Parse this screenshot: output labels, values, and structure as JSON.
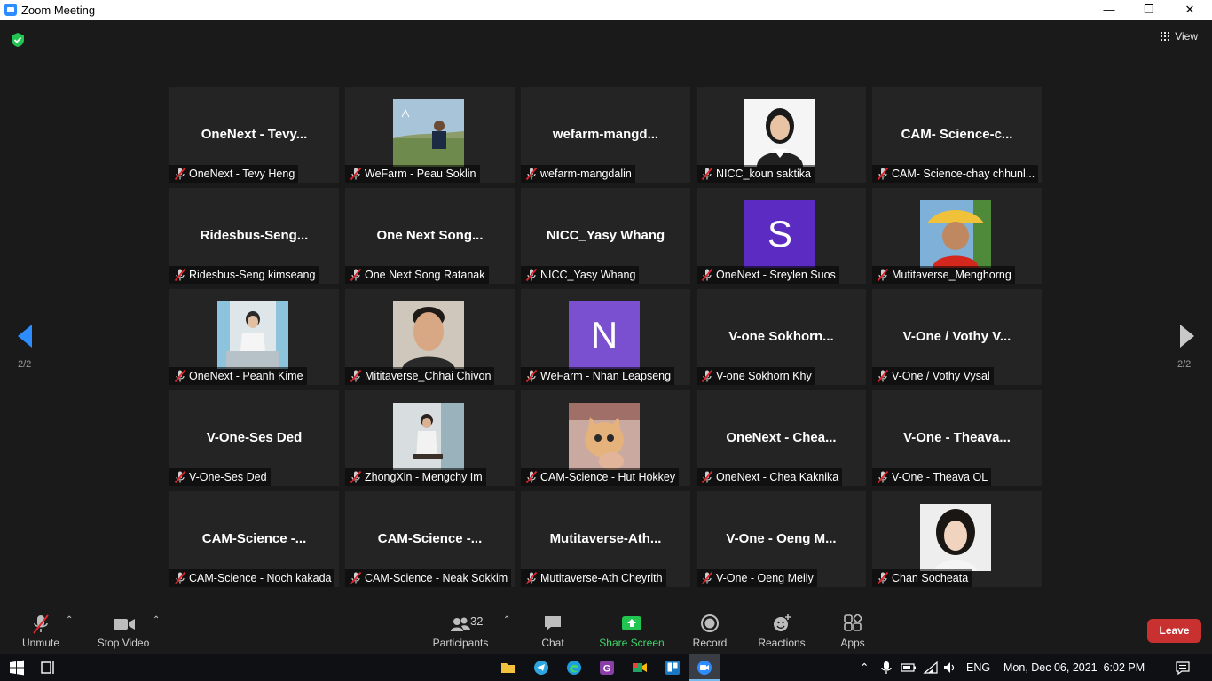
{
  "window": {
    "title": "Zoom Meeting",
    "minimize": "—",
    "restore": "❐",
    "close": "✕"
  },
  "header": {
    "view_label": "View"
  },
  "nav": {
    "page_left": "2/2",
    "page_right": "2/2"
  },
  "tiles": [
    {
      "big": "OneNext  - Tevy...",
      "label": "OneNext - Tevy Heng"
    },
    {
      "big": "",
      "label": "WeFarm - Peau Soklin",
      "photo": "photo-man-field"
    },
    {
      "big": "wefarm-mangd...",
      "label": "wefarm-mangdalin"
    },
    {
      "big": "",
      "label": "NICC_koun saktika",
      "photo": "photo-woman-portrait"
    },
    {
      "big": "CAM-  Science-c...",
      "label": "CAM- Science-chay chhunl..."
    },
    {
      "big": "Ridesbus-Seng...",
      "label": "Ridesbus-Seng kimseang"
    },
    {
      "big": "One  Next  Song...",
      "label": "One Next Song Ratanak"
    },
    {
      "big": "NICC_Yasy Whang",
      "label": "NICC_Yasy Whang"
    },
    {
      "big": "",
      "label": "OneNext - Sreylen Suos",
      "letter": "S",
      "letter_color": "#5b2bc2"
    },
    {
      "big": "",
      "label": "Mutitaverse_Menghorng",
      "photo": "photo-hat-person"
    },
    {
      "big": "",
      "label": "OneNext - Peanh Kime",
      "photo": "photo-man-sitting"
    },
    {
      "big": "",
      "label": "Mititaverse_Chhai Chivon",
      "photo": "photo-man-face"
    },
    {
      "big": "",
      "label": "WeFarm - Nhan Leapseng",
      "letter": "N",
      "letter_color": "#7a4fd0"
    },
    {
      "big": "V-one  Sokhorn...",
      "label": "V-one Sokhorn Khy"
    },
    {
      "big": "V-One / Vothy V...",
      "label": "V-One / Vothy Vysal"
    },
    {
      "big": "V-One-Ses Ded",
      "label": "V-One-Ses Ded"
    },
    {
      "big": "",
      "label": "ZhongXin - Mengchy Im",
      "photo": "photo-man-standing"
    },
    {
      "big": "",
      "label": "CAM-Science - Hut Hokkey",
      "photo": "photo-kitten"
    },
    {
      "big": "OneNext  - Chea...",
      "label": "OneNext - Chea Kaknika"
    },
    {
      "big": "V-One  - Theava...",
      "label": "V-One - Theava OL"
    },
    {
      "big": "CAM-Science  -...",
      "label": "CAM-Science - Noch kakada"
    },
    {
      "big": "CAM-Science  -...",
      "label": "CAM-Science - Neak Sokkim"
    },
    {
      "big": "Mutitaverse-Ath...",
      "label": "Mutitaverse-Ath Cheyrith"
    },
    {
      "big": "V-One  - Oeng M...",
      "label": "V-One - Oeng Meily"
    },
    {
      "big": "",
      "label": "Chan Socheata",
      "photo": "photo-woman-face"
    }
  ],
  "toolbar": {
    "unmute": "Unmute",
    "stop_video": "Stop Video",
    "participants": "Participants",
    "participants_count": "32",
    "chat": "Chat",
    "share_screen": "Share Screen",
    "record": "Record",
    "reactions": "Reactions",
    "apps": "Apps",
    "leave": "Leave"
  },
  "taskbar": {
    "language": "ENG",
    "datetime": "Mon, Dec 06, 2021  6:02 PM",
    "icons": [
      "windows-start-icon",
      "task-view-icon",
      "file-explorer-icon",
      "telegram-icon",
      "edge-icon",
      "app-g-icon",
      "meet-icon",
      "trello-icon",
      "zoom-icon"
    ]
  },
  "colors": {
    "accent_green": "#3fd86a",
    "leave_red": "#c93030",
    "tile_bg": "#242424",
    "zoom_blue": "#2d8cff"
  }
}
